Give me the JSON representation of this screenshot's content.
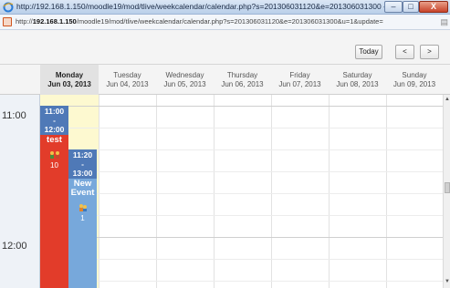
{
  "window": {
    "title": "http://192.168.1.150/moodle19/mod/tlive/weekcalendar/calendar.php?s=201306031120&e=201306031300 - Windows Intern...",
    "buttons": {
      "minimize": "–",
      "maximize": "□",
      "close": "X"
    }
  },
  "address": {
    "prefix": "http://",
    "host": "192.168.1.150",
    "path": "/moodle19/mod/tlive/weekcalendar/calendar.php?s=201306031120&e=201306031300&u=1&update="
  },
  "toolbar": {
    "today_label": "Today",
    "prev_label": "<",
    "next_label": ">"
  },
  "days": [
    {
      "name": "Monday",
      "date": "Jun 03, 2013",
      "active": true
    },
    {
      "name": "Tuesday",
      "date": "Jun 04, 2013",
      "active": false
    },
    {
      "name": "Wednesday",
      "date": "Jun 05, 2013",
      "active": false
    },
    {
      "name": "Thursday",
      "date": "Jun 06, 2013",
      "active": false
    },
    {
      "name": "Friday",
      "date": "Jun 07, 2013",
      "active": false
    },
    {
      "name": "Saturday",
      "date": "Jun 08, 2013",
      "active": false
    },
    {
      "name": "Sunday",
      "date": "Jun 09, 2013",
      "active": false
    }
  ],
  "times": [
    "11:00",
    "12:00"
  ],
  "events": [
    {
      "start": "11:00",
      "sep": "-",
      "end": "12:00",
      "title": "test",
      "count": "10",
      "color": "#e23c2a"
    },
    {
      "start": "11:20",
      "sep": "-",
      "end": "13:00",
      "title": "New Event",
      "count": "1",
      "color": "#77a8db"
    }
  ],
  "colors": {
    "today_column": "#fdf9d0",
    "time_header": "#4f79b7",
    "gutter": "#eef2f7"
  }
}
